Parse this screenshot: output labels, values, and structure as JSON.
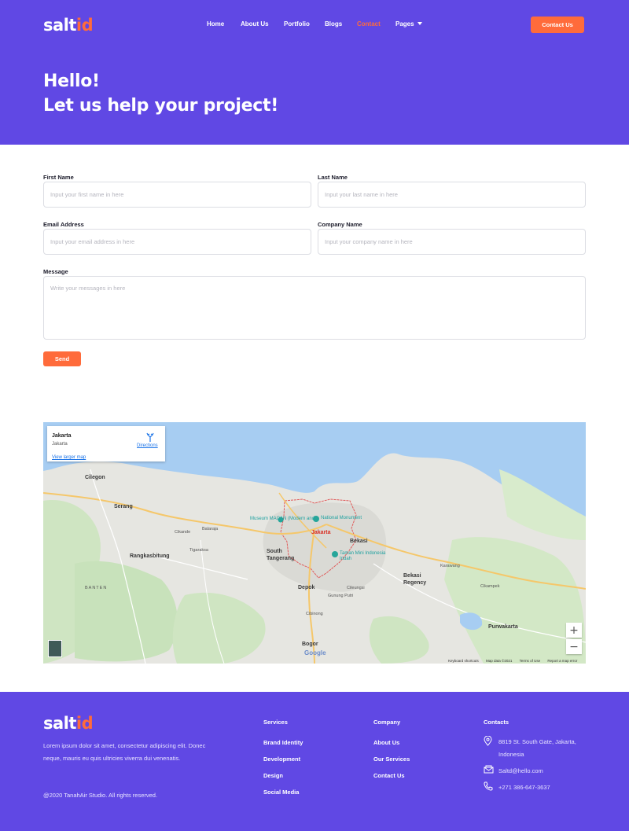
{
  "brand": {
    "part1": "salt",
    "part2": "id"
  },
  "colors": {
    "primary": "#6048e4",
    "accent": "#ff6b3b"
  },
  "nav": {
    "items": [
      {
        "label": "Home"
      },
      {
        "label": "About Us"
      },
      {
        "label": "Portfolio"
      },
      {
        "label": "Blogs"
      },
      {
        "label": "Contact",
        "active": true
      },
      {
        "label": "Pages",
        "icon": "chevron-down-icon"
      }
    ],
    "cta_label": "Contact Us"
  },
  "hero": {
    "line1": "Hello!",
    "line2": "Let us help your project!"
  },
  "form": {
    "first_name": {
      "label": "First Name",
      "placeholder": "Input your first name in here",
      "value": ""
    },
    "last_name": {
      "label": "Last Name",
      "placeholder": "Input your last name in here",
      "value": ""
    },
    "email": {
      "label": "Email Address",
      "placeholder": "Input your email address in here",
      "value": ""
    },
    "company": {
      "label": "Company Name",
      "placeholder": "Input your company name in here",
      "value": ""
    },
    "message": {
      "label": "Message",
      "placeholder": "Write your messages in here",
      "value": ""
    },
    "send_label": "Send"
  },
  "map": {
    "card": {
      "title": "Jakarta",
      "subtitle": "Jakarta",
      "larger_link": "View larger map",
      "directions": "Directions"
    },
    "places": {
      "cilegon": "Cilegon",
      "serang": "Serang",
      "jakarta": "Jakarta",
      "bekasi": "Bekasi",
      "south_tangerang": "South Tangerang",
      "depok": "Depok",
      "bekasi_regency": "Bekasi Regency",
      "bogor": "Bogor",
      "purwakarta": "Purwakarta",
      "rangkasbitung": "Rangkasbitung",
      "banten": "BANTEN",
      "cibinong": "Cibinong",
      "cileungsi": "Cileungsi",
      "gunung_putri": "Gunung Putri",
      "museum_macan": "Museum MACAN (Modern and...",
      "national_monument": "National Monument",
      "taman_mini": "Taman Mini Indonesia Indah",
      "karawang": "Karawang",
      "cikampek": "Cikampek",
      "balaraja": "Balaraja",
      "tigaraksa": "Tigaraksa",
      "cikande": "Cikande"
    },
    "zoom_in": "+",
    "zoom_out": "−",
    "google": "Google",
    "footer": {
      "shortcuts": "Keyboard shortcuts",
      "data": "Map data ©2021",
      "terms": "Terms of Use",
      "report": "Report a map error"
    }
  },
  "footer": {
    "description": "Lorem ipsum dolor sit amet, consectetur adipiscing elit. Donec neque, mauris eu quis ultricies viverra dui venenatis.",
    "copyright": "@2020 TanahAir Studio. All rights reserved.",
    "services": {
      "heading": "Services",
      "links": [
        "Brand Identity",
        "Development",
        "Design",
        "Social Media"
      ]
    },
    "company": {
      "heading": "Company",
      "links": [
        "About Us",
        "Our Services",
        "Contact Us"
      ]
    },
    "contacts": {
      "heading": "Contacts",
      "address": "8819 St. South Gate, Jakarta, Indonesia",
      "email": "Saltd@hello.com",
      "phone": "+271 386-647-3637"
    }
  }
}
